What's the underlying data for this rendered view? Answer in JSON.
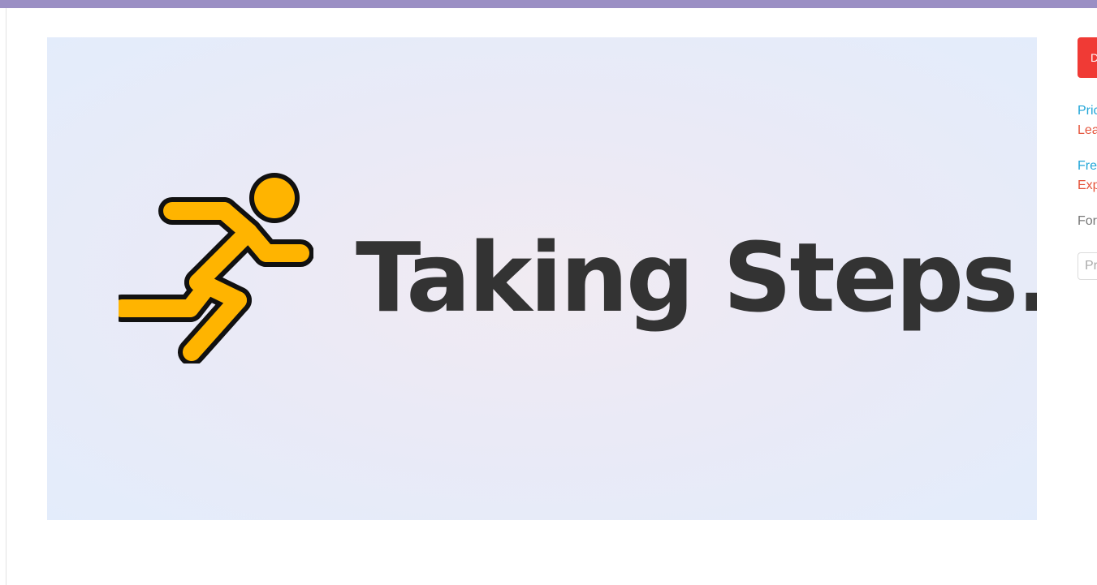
{
  "hero": {
    "title": "Taking Steps."
  },
  "icons": {
    "runner": "running-person-icon"
  },
  "sidebar": {
    "button_label": "D",
    "link1_title": "Pric",
    "link1_action": "Lea",
    "link2_title": "Fre",
    "link2_action": "Exp",
    "label": "For",
    "input_placeholder": "Pr"
  },
  "colors": {
    "top_bar": "#9b8fc4",
    "button": "#f03a35",
    "link": "#22a6d8",
    "accent_red": "#e5543c",
    "icon_fill": "#ffb400",
    "title_text": "#333333"
  }
}
